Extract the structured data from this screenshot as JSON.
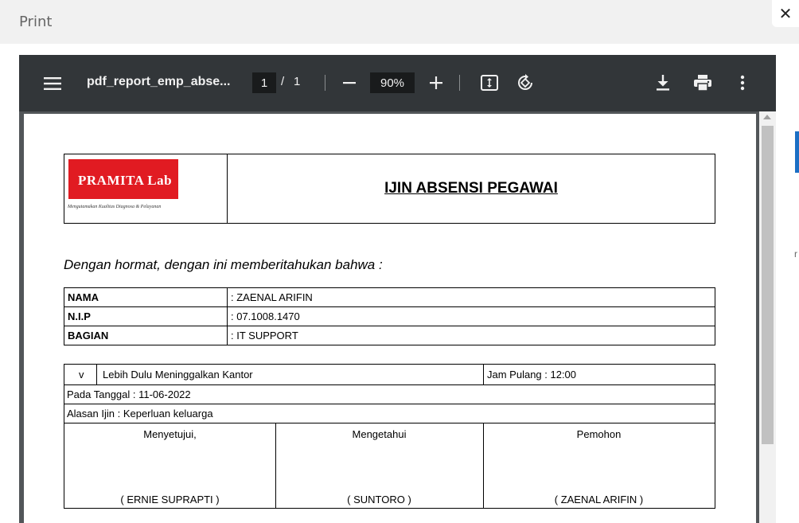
{
  "dialog": {
    "title": "Print",
    "close_glyph": "✕"
  },
  "side_strip": {
    "mark": "r"
  },
  "toolbar": {
    "menu_icon": "☰",
    "doc_name": "pdf_report_emp_abse...",
    "page_current": "1",
    "page_separator": "/",
    "page_total": "1",
    "zoom_out_icon": "−",
    "zoom": "90%",
    "zoom_in_icon": "+",
    "fit_page_icon": "fit-page-icon",
    "rotate_icon": "rotate-icon",
    "download_icon": "download-icon",
    "print_icon": "print-icon",
    "more_icon": "more-vert-icon"
  },
  "document": {
    "logo_text": "PRAMITA Lab",
    "logo_tagline": "Mengutamakan Kualitas Diagnosa & Pelayanan",
    "title": "IJIN ABSENSI PEGAWAI",
    "greeting": "Dengan hormat, dengan ini memberitahukan bahwa :",
    "info_rows": [
      {
        "label": "NAMA",
        "value": ": ZAENAL ARIFIN"
      },
      {
        "label": "N.I.P",
        "value": ": 07.1008.1470"
      },
      {
        "label": "BAGIAN",
        "value": ": IT SUPPORT"
      }
    ],
    "check_mark": "v",
    "leave_type": "Lebih Dulu Meninggalkan Kantor",
    "jam_pulang": "Jam Pulang :  12:00",
    "pada_tanggal": "Pada Tanggal :  11-06-2022",
    "alasan": "Alasan Ijin :  Keperluan keluarga",
    "signatures": [
      {
        "role": "Menyetujui,",
        "name": "( ERNIE SUPRAPTI )"
      },
      {
        "role": "Mengetahui",
        "name": "( SUNTORO )"
      },
      {
        "role": "Pemohon",
        "name": "( ZAENAL ARIFIN )"
      }
    ]
  }
}
